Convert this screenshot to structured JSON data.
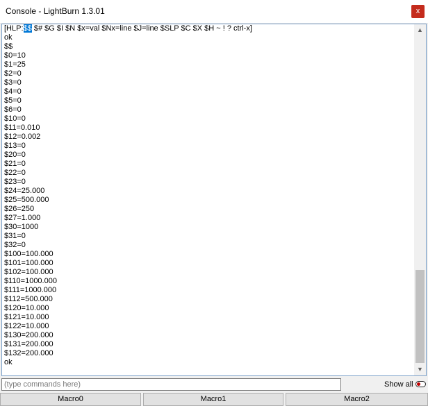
{
  "window": {
    "title": "Console - LightBurn 1.3.01",
    "close_label": "x"
  },
  "console": {
    "first_line": {
      "prefix": "[HLP:",
      "highlight": "$$",
      "suffix": " $# $G $I $N $x=val $Nx=line $J=line $SLP $C $X $H ~ ! ? ctrl-x]"
    },
    "lines": [
      "ok",
      "$$",
      "$0=10",
      "$1=25",
      "$2=0",
      "$3=0",
      "$4=0",
      "$5=0",
      "$6=0",
      "$10=0",
      "$11=0.010",
      "$12=0.002",
      "$13=0",
      "$20=0",
      "$21=0",
      "$22=0",
      "$23=0",
      "$24=25.000",
      "$25=500.000",
      "$26=250",
      "$27=1.000",
      "$30=1000",
      "$31=0",
      "$32=0",
      "$100=100.000",
      "$101=100.000",
      "$102=100.000",
      "$110=1000.000",
      "$111=1000.000",
      "$112=500.000",
      "$120=10.000",
      "$121=10.000",
      "$122=10.000",
      "$130=200.000",
      "$131=200.000",
      "$132=200.000",
      "ok"
    ]
  },
  "command": {
    "value": "",
    "placeholder": "(type commands here)"
  },
  "show_all": {
    "label": "Show all",
    "checked": false,
    "accent": "#c00000"
  },
  "macros": [
    {
      "label": "Macro0"
    },
    {
      "label": "Macro1"
    },
    {
      "label": "Macro2"
    }
  ],
  "colors": {
    "close_button": "#c42b1c",
    "selection": "#0078d7",
    "console_border": "#7a9fc8"
  }
}
